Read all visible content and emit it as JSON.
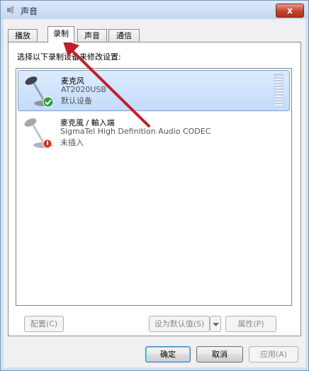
{
  "window": {
    "title": "声音",
    "close_label": "x"
  },
  "tabs": [
    {
      "label": "播放"
    },
    {
      "label": "录制"
    },
    {
      "label": "声音"
    },
    {
      "label": "通信"
    }
  ],
  "instruction": "选择以下录制设备来修改设置:",
  "devices": [
    {
      "name": "麦克风",
      "description": "AT2020USB",
      "status": "默认设备"
    },
    {
      "name": "麥克風 / 輸入端",
      "description": "SigmaTel High Definition Audio CODEC",
      "status": "未插入"
    }
  ],
  "buttons": {
    "configure": "配置(C)",
    "set_default": "设为默认值(S)",
    "properties": "属性(P)",
    "ok": "确定",
    "cancel": "取消",
    "apply": "应用(A)"
  },
  "colors": {
    "annotation_arrow": "#c0202a"
  }
}
